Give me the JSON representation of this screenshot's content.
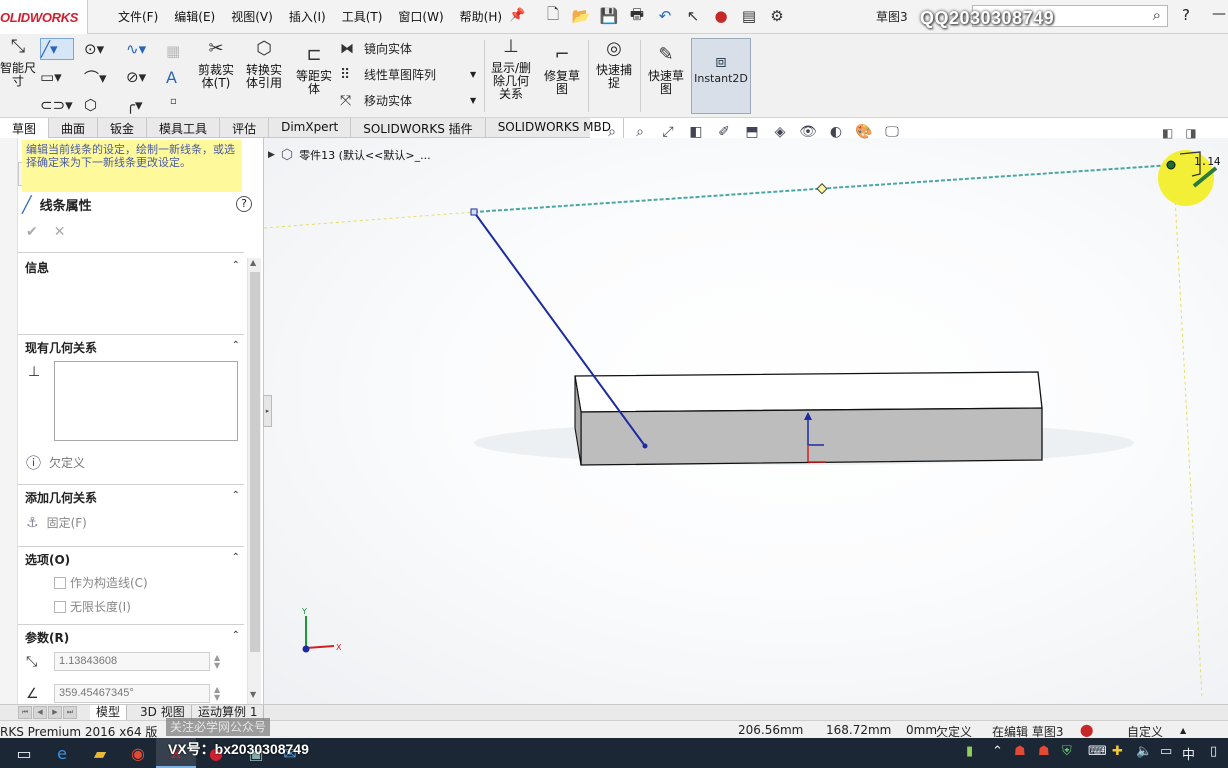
{
  "app": {
    "logo_text": "OLIDWORKS",
    "menu": [
      "文件(F)",
      "编辑(E)",
      "视图(V)",
      "插入(I)",
      "工具(T)",
      "窗口(W)",
      "帮助(H)"
    ],
    "doc_title": "草图3",
    "watermark": "QQ2030308749",
    "help_label": "?"
  },
  "commands": {
    "smart_dim": "智能尺\n寸",
    "trim": "剪裁实\n体(T)",
    "convert": "转换实\n体引用",
    "offset": "等距实\n体",
    "mirror": "镜向实体",
    "linear_pattern": "线性草图阵列",
    "move": "移动实体",
    "show_relations": "显示/删\n除几何\n关系",
    "repair": "修复草\n图",
    "quick_snaps": "快速捕\n捉",
    "rapid_sketch": "快速草\n图",
    "instant2d": "Instant2D"
  },
  "tabs": [
    {
      "label": "草图",
      "active": true
    },
    {
      "label": "曲面",
      "active": false
    },
    {
      "label": "钣金",
      "active": false
    },
    {
      "label": "模具工具",
      "active": false
    },
    {
      "label": "评估",
      "active": false
    },
    {
      "label": "DimXpert",
      "active": false
    },
    {
      "label": "SOLIDWORKS 插件",
      "active": false
    },
    {
      "label": "SOLIDWORKS MBD",
      "active": false
    }
  ],
  "tree": {
    "part_label": "零件13 (默认<<默认>_..."
  },
  "property_manager": {
    "title": "线条属性",
    "info": {
      "header": "信息",
      "text": "编辑当前线条的设定，绘制一新线条，或选择确定来为下一新线条更改设定。"
    },
    "existing_relations": {
      "header": "现有几何关系",
      "status": "欠定义"
    },
    "add_relations": {
      "header": "添加几何关系",
      "fix_label": "固定(F)"
    },
    "options": {
      "header": "选项(O)",
      "construction": "作为构造线(C)",
      "infinite": "无限长度(I)"
    },
    "parameters": {
      "header": "参数(R)",
      "length": "1.13843608",
      "angle": "359.45467345°"
    }
  },
  "viewport": {
    "callout_value": "1.14",
    "axis_y": "Y",
    "axis_x": "X"
  },
  "bottom_tabs": [
    {
      "label": "模型",
      "active": true
    },
    {
      "label": "3D 视图",
      "active": false
    },
    {
      "label": "运动算例 1",
      "active": false
    }
  ],
  "status": {
    "product": "RKS Premium 2016 x64 版",
    "x": "206.56mm",
    "y": "168.72mm",
    "z": "0mm",
    "defined": "欠定义",
    "editing": "在编辑 草图3",
    "custom": "自定义",
    "gongzhonghao": "关注必学网公众号"
  },
  "taskbar": {
    "wechat": "VX号：bx2030308749",
    "lang": "中"
  }
}
